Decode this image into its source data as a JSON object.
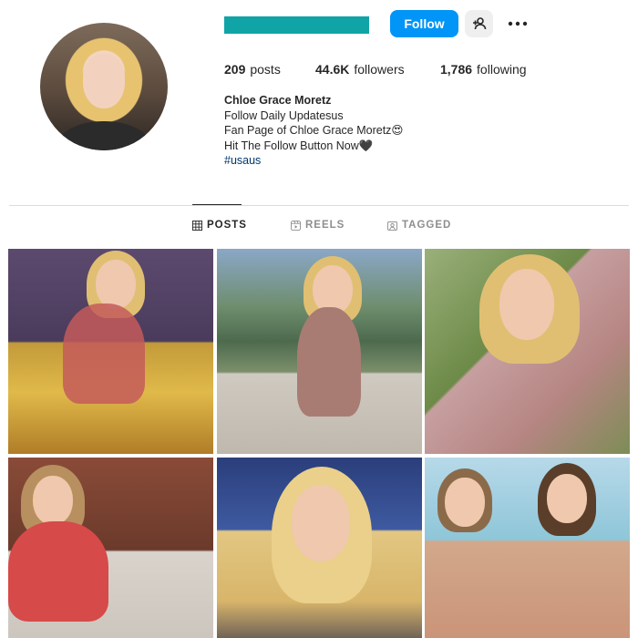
{
  "header": {
    "follow_label": "Follow",
    "suggest_icon": "add-person-icon",
    "more_icon": "more-dots-icon"
  },
  "stats": {
    "posts_count": "209",
    "posts_label": "posts",
    "followers_count": "44.6K",
    "followers_label": "followers",
    "following_count": "1,786",
    "following_label": "following"
  },
  "bio": {
    "name": "Chloe Grace Moretz",
    "line1": "Follow Daily Updatesus",
    "line2": "Fan Page of Chloe Grace Moretz😍",
    "line3": "Hit The Follow Button Now🖤",
    "hashtag": "#usaus"
  },
  "tabs": [
    {
      "label": "POSTS",
      "icon": "grid-icon",
      "active": true
    },
    {
      "label": "REELS",
      "icon": "reels-icon",
      "active": false
    },
    {
      "label": "TAGGED",
      "icon": "tagged-icon",
      "active": false
    }
  ],
  "colors": {
    "accent": "#0095f6",
    "redacted_username": "#10a4a7"
  }
}
